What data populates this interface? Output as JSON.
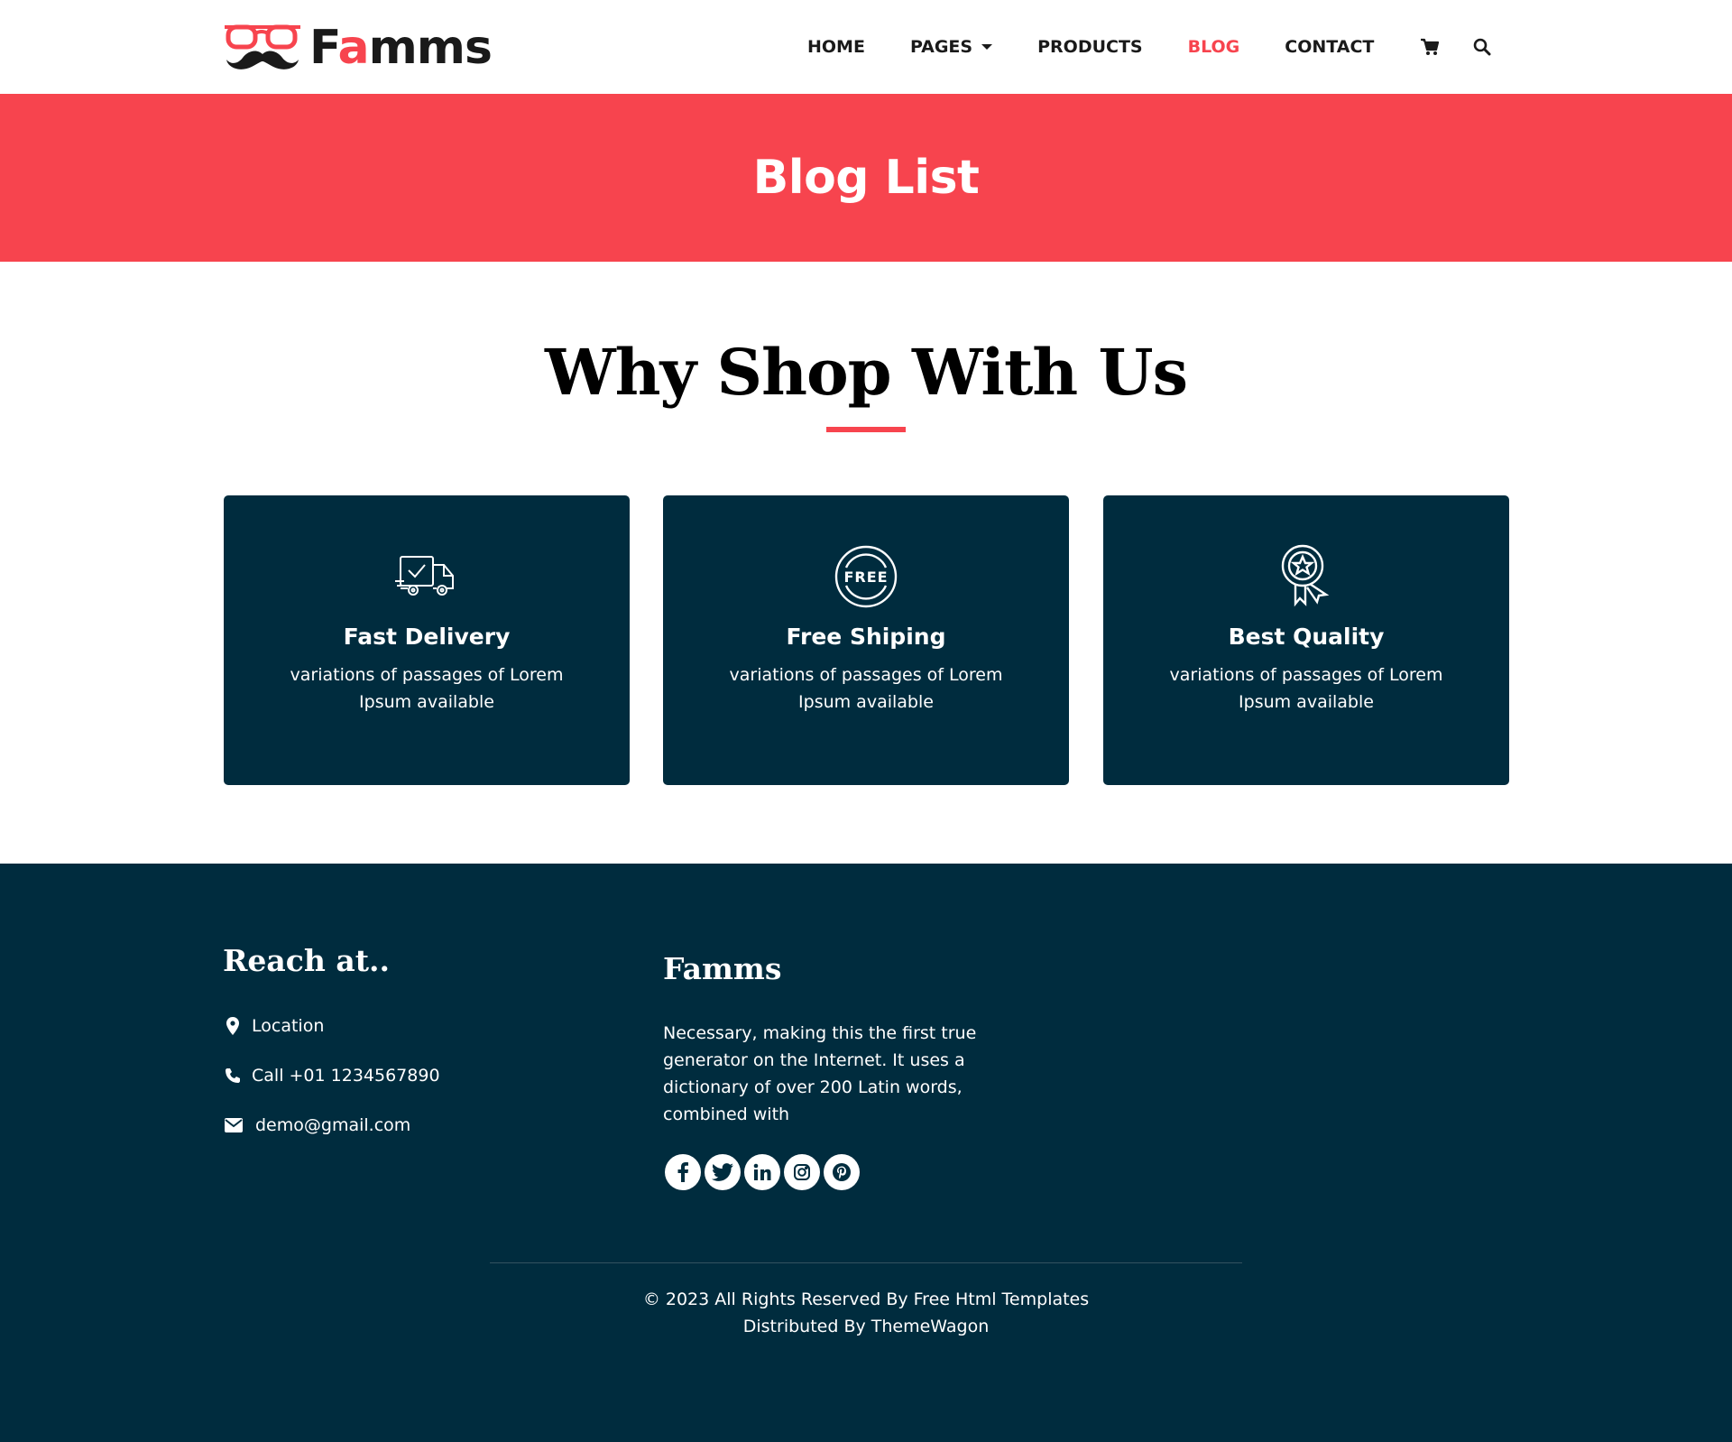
{
  "brand": {
    "name_prefix": "F",
    "name_accent": "a",
    "name_suffix": "mms",
    "accent_color": "#f7444e",
    "dark_color": "#002c3e"
  },
  "nav": {
    "items": [
      {
        "label": "HOME"
      },
      {
        "label": "PAGES"
      },
      {
        "label": "PRODUCTS"
      },
      {
        "label": "BLOG"
      },
      {
        "label": "CONTACT"
      }
    ],
    "active": "BLOG",
    "icons": [
      "cart-icon",
      "search-icon"
    ]
  },
  "banner": {
    "title": "Blog List"
  },
  "why": {
    "title": "Why Shop With Us",
    "cards": [
      {
        "icon": "delivery-truck-icon",
        "title": "Fast Delivery",
        "text": "variations of passages of Lorem Ipsum available"
      },
      {
        "icon": "free-badge-icon",
        "title": "Free Shiping",
        "text": "variations of passages of Lorem Ipsum available"
      },
      {
        "icon": "award-ribbon-icon",
        "title": "Best Quality",
        "text": "variations of passages of Lorem Ipsum available"
      }
    ]
  },
  "footer": {
    "reach_heading": "Reach at..",
    "location": "Location",
    "phone": "Call +01 1234567890",
    "email": "demo@gmail.com",
    "brand_heading": "Famms",
    "about": "Necessary, making this the first true generator on the Internet. It uses a dictionary of over 200 Latin words, combined with",
    "socials": [
      "facebook-icon",
      "twitter-icon",
      "linkedin-icon",
      "instagram-icon",
      "pinterest-icon"
    ],
    "copyright_line1": "© 2023 All Rights Reserved By Free Html Templates",
    "copyright_line2": "Distributed By ThemeWagon"
  }
}
